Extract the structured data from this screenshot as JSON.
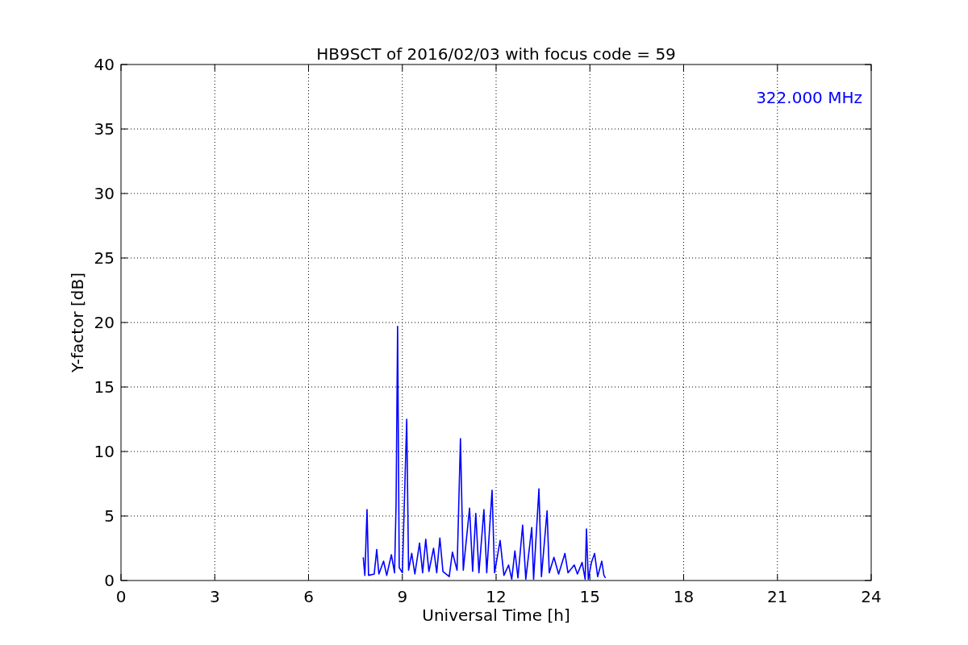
{
  "chart_data": {
    "type": "line",
    "title": "HB9SCT of 2016/02/03 with focus code = 59",
    "xlabel": "Universal Time [h]",
    "ylabel": "Y-factor [dB]",
    "x": [
      7.75,
      7.8,
      7.87,
      7.92,
      8.1,
      8.18,
      8.25,
      8.4,
      8.5,
      8.65,
      8.75,
      8.8,
      8.85,
      8.9,
      9.0,
      9.14,
      9.2,
      9.3,
      9.4,
      9.55,
      9.65,
      9.75,
      9.85,
      10.0,
      10.1,
      10.2,
      10.3,
      10.5,
      10.6,
      10.75,
      10.86,
      10.95,
      11.15,
      11.25,
      11.35,
      11.45,
      11.61,
      11.7,
      11.87,
      11.95,
      12.13,
      12.25,
      12.4,
      12.5,
      12.6,
      12.7,
      12.85,
      12.95,
      13.14,
      13.2,
      13.37,
      13.45,
      13.63,
      13.7,
      13.85,
      14.0,
      14.2,
      14.3,
      14.5,
      14.6,
      14.75,
      14.85,
      14.89,
      14.95,
      15.05,
      15.15,
      15.25,
      15.38,
      15.45,
      15.5
    ],
    "series": [
      {
        "color": "#0000ff",
        "values": [
          1.8,
          0.4,
          5.5,
          0.4,
          0.5,
          2.4,
          0.5,
          1.5,
          0.4,
          2.0,
          0.6,
          5.9,
          19.7,
          1.0,
          0.6,
          12.5,
          0.8,
          2.1,
          0.5,
          2.9,
          0.6,
          3.2,
          0.7,
          2.5,
          0.6,
          3.3,
          0.7,
          0.3,
          2.2,
          0.8,
          11.0,
          0.8,
          5.6,
          0.7,
          5.2,
          0.6,
          5.5,
          0.6,
          7.0,
          0.6,
          3.1,
          0.4,
          1.2,
          0.1,
          2.3,
          0.2,
          4.3,
          0.1,
          4.1,
          0.1,
          7.1,
          0.3,
          5.4,
          0.6,
          1.8,
          0.5,
          2.1,
          0.6,
          1.2,
          0.5,
          1.4,
          0.1,
          4.0,
          0.1,
          1.4,
          2.1,
          0.3,
          1.5,
          0.4,
          0.2
        ]
      }
    ],
    "xlim": [
      0,
      24
    ],
    "ylim": [
      0,
      40
    ],
    "xticks": [
      0,
      3,
      6,
      9,
      12,
      15,
      18,
      21,
      24
    ],
    "yticks": [
      0,
      5,
      10,
      15,
      20,
      25,
      30,
      35,
      40
    ],
    "grid": true,
    "annotations": [
      "322.000 MHz"
    ]
  }
}
